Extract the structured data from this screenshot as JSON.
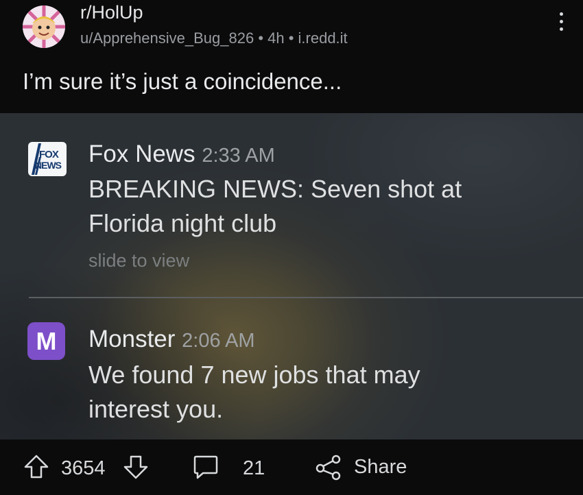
{
  "post": {
    "subreddit": "r/HolUp",
    "author_line": "u/Apprehensive_Bug_826 • 4h • i.redd.it",
    "title": "I’m sure it’s just a coincidence..."
  },
  "image": {
    "notification_1": {
      "logo_text_line1": "FOX",
      "logo_text_line2": "NEWS",
      "app": "Fox News",
      "time": "2:33 AM",
      "line1": "BREAKING NEWS: Seven shot at",
      "line2": "Florida night club",
      "hint": "slide to view"
    },
    "notification_2": {
      "logo_letter": "M",
      "app": "Monster",
      "time": "2:06 AM",
      "line1": "We found 7 new jobs that may",
      "line2": "interest you."
    }
  },
  "actions": {
    "votes": "3654",
    "comments": "21",
    "share": "Share"
  },
  "colors": {
    "background": "#0b0b0c",
    "monster_purple": "#7d4fc8",
    "fox_blue": "#163a6e"
  },
  "icons": [
    "avatar",
    "more-vertical-icon",
    "upvote-icon",
    "downvote-icon",
    "comment-icon",
    "share-icon"
  ]
}
